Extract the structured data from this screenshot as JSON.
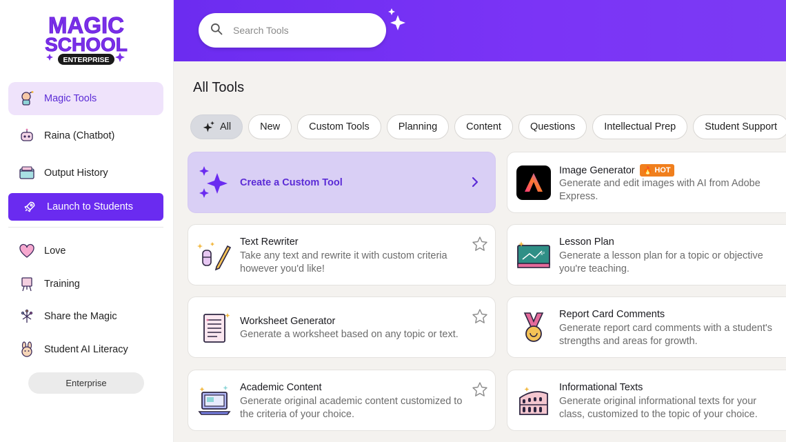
{
  "logo": {
    "line1": "MAGIC",
    "line2": "SCHOOL",
    "badge": "ENTERPRISE"
  },
  "sidebar": {
    "items": [
      {
        "label": "Magic Tools",
        "icon": "magic-tools-icon"
      },
      {
        "label": "Raina (Chatbot)",
        "icon": "robot-icon"
      },
      {
        "label": "Output History",
        "icon": "history-folder-icon"
      },
      {
        "label": "Launch to Students",
        "icon": "rocket-icon"
      },
      {
        "label": "Love",
        "icon": "heart-icon"
      },
      {
        "label": "Training",
        "icon": "easel-icon"
      },
      {
        "label": "Share the Magic",
        "icon": "firework-icon"
      },
      {
        "label": "Student AI Literacy",
        "icon": "bunny-icon"
      }
    ],
    "enterprise_label": "Enterprise"
  },
  "search": {
    "placeholder": "Search Tools"
  },
  "main": {
    "title": "All Tools",
    "filters": [
      "All",
      "New",
      "Custom Tools",
      "Planning",
      "Content",
      "Questions",
      "Intellectual Prep",
      "Student Support"
    ],
    "custom_tool": {
      "label": "Create a Custom Tool"
    },
    "tools": [
      {
        "title": "Image Generator",
        "badge": "HOT",
        "desc": "Generate and edit images with AI from Adobe Express.",
        "icon": "adobe-express-icon"
      },
      {
        "title": "Text Rewriter",
        "desc": "Take any text and rewrite it with custom criteria however you'd like!",
        "icon": "pencil-eraser-icon"
      },
      {
        "title": "Lesson Plan",
        "desc": "Generate a lesson plan for a topic or objective you're teaching.",
        "icon": "chalkboard-icon"
      },
      {
        "title": "Worksheet Generator",
        "desc": "Generate a worksheet based on any topic or text.",
        "icon": "worksheet-icon"
      },
      {
        "title": "Report Card Comments",
        "desc": "Generate report card comments with a student's strengths and areas for growth.",
        "icon": "medal-icon"
      },
      {
        "title": "Academic Content",
        "desc": "Generate original academic content customized to the criteria of your choice.",
        "icon": "laptop-icon"
      },
      {
        "title": "Informational Texts",
        "desc": "Generate original informational texts for your class, customized to the topic of your choice.",
        "icon": "colosseum-icon"
      }
    ]
  },
  "colors": {
    "brand_purple": "#6c2cf0",
    "active_bg": "#efe3fb",
    "custom_card_bg": "#d9cff5",
    "hot_orange": "#f07f1d"
  }
}
